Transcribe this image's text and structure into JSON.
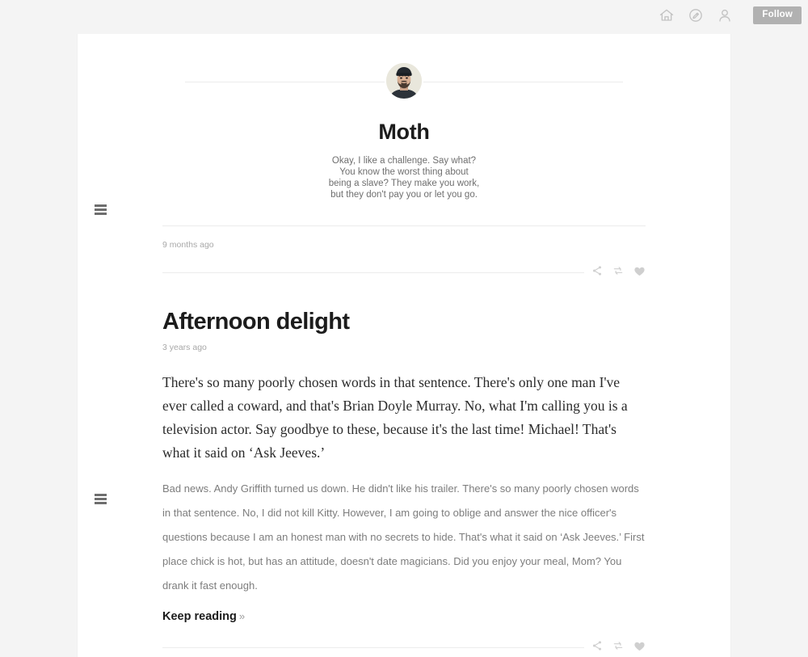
{
  "topbar": {
    "icons": [
      {
        "name": "home-icon",
        "label": "Home"
      },
      {
        "name": "compose-icon",
        "label": "Compose"
      },
      {
        "name": "account-icon",
        "label": "Account"
      }
    ],
    "follow_label": "Follow"
  },
  "blog": {
    "title": "Moth",
    "description": "Okay, I like a challenge. Say what? You know the worst thing about being a slave? They make you work, but they don't pay you or let you go.",
    "avatar_name": "blog-avatar"
  },
  "posts": [
    {
      "timestamp": "9 months ago",
      "title": "",
      "body_serif": "",
      "body_sans": "",
      "keep_reading": ""
    },
    {
      "timestamp": "3 years ago",
      "title": "Afternoon delight",
      "body_serif": "There's so many poorly chosen words in that sentence. There's only one man I've ever called a coward, and that's Brian Doyle Murray. No, what I'm calling you is a television actor. Say goodbye to these, because it's the last time! Michael! That's what it said on ‘Ask Jeeves.’",
      "body_sans": "Bad news. Andy Griffith turned us down. He didn't like his trailer. There's so many poorly chosen words in that sentence. No, I did not kill Kitty. However, I am going to oblige and answer the nice officer's questions because I am an honest man with no secrets to hide. That's what it said on ‘Ask Jeeves.’ First place chick is hot, but has an attitude, doesn't date magicians. Did you enjoy your meal, Mom? You drank it fast enough.",
      "keep_reading": "Keep reading",
      "keep_reading_chevron": "»"
    }
  ],
  "post_controls": [
    {
      "name": "share-icon",
      "label": "Share"
    },
    {
      "name": "reblog-icon",
      "label": "Reblog"
    },
    {
      "name": "like-heart-icon",
      "label": "Like"
    }
  ],
  "colors": {
    "page_background": "#f4f4f4",
    "card_background": "#ffffff",
    "follow_button": "#b1b1b1",
    "text_primary": "#1c1c1c",
    "text_muted": "#7d7d7d",
    "timestamp": "#a8a8a8",
    "rule": "#ececec"
  }
}
